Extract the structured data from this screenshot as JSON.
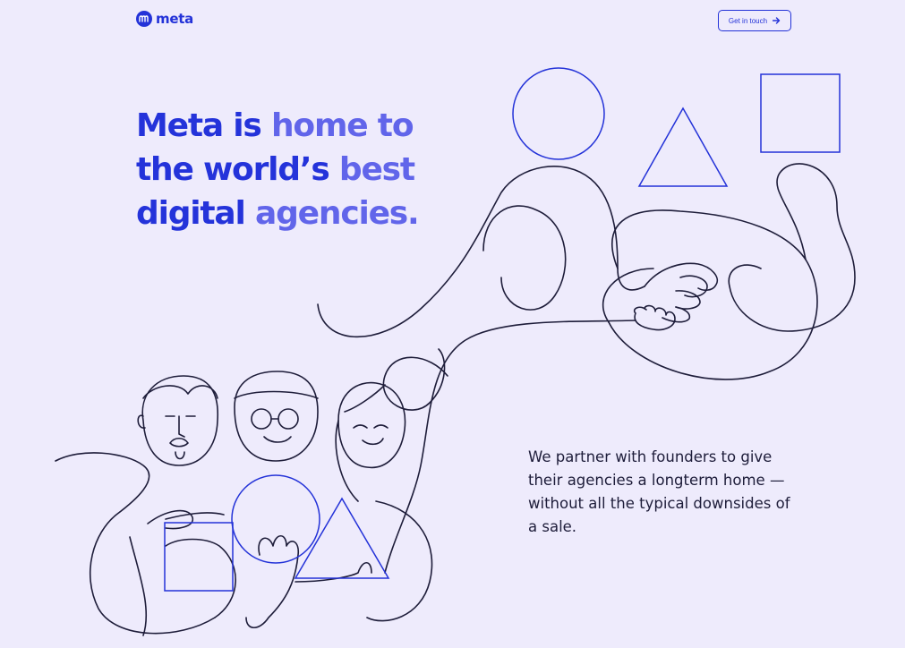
{
  "header": {
    "logo_text": "meta",
    "cta_label": "Get in touch"
  },
  "hero": {
    "headline_lines": [
      {
        "strong": "Meta is",
        "light": " home to"
      },
      {
        "strong": "the world’s",
        "light": " best"
      },
      {
        "strong": "digital",
        "light": " agencies."
      }
    ],
    "body": "We partner with founders to give their agencies a longterm home — without all the typical downsides of a sale."
  },
  "colors": {
    "background": "#eeebfc",
    "brand_blue": "#2332d8",
    "brand_blue_light": "#6165ea",
    "line_dark": "#1e1d3a"
  },
  "icons": {
    "logo": "meta-logo-icon",
    "cta_arrow": "arrow-right-icon"
  }
}
